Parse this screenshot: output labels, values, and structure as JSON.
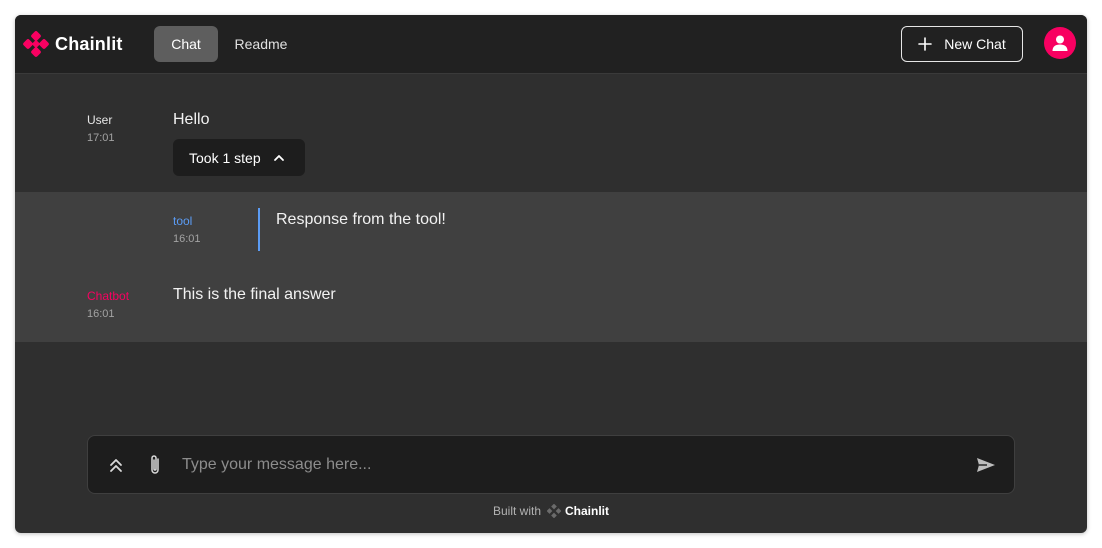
{
  "header": {
    "brand": "Chainlit",
    "tabs": [
      {
        "label": "Chat",
        "active": true
      },
      {
        "label": "Readme",
        "active": false
      }
    ],
    "new_chat_label": "New Chat",
    "accent_color": "#f80061"
  },
  "messages": [
    {
      "author": "User",
      "time": "17:01",
      "content": "Hello",
      "step_toggle_label": "Took 1 step"
    },
    {
      "author": "tool",
      "time": "16:01",
      "content": "Response from the tool!",
      "author_color": "#5b9cf5"
    },
    {
      "author": "Chatbot",
      "time": "16:01",
      "content": "This is the final answer",
      "author_color": "#f80061"
    }
  ],
  "composer": {
    "placeholder": "Type your message here...",
    "value": ""
  },
  "footer": {
    "built_with": "Built with",
    "brand": "Chainlit"
  },
  "icons": {
    "logo": "chainlit-logo-icon",
    "new_chat": "plus-icon",
    "avatar": "user-icon",
    "step_toggle": "chevron-up-icon",
    "settings": "double-chevron-up-icon",
    "attach": "paperclip-icon",
    "send": "send-icon"
  }
}
